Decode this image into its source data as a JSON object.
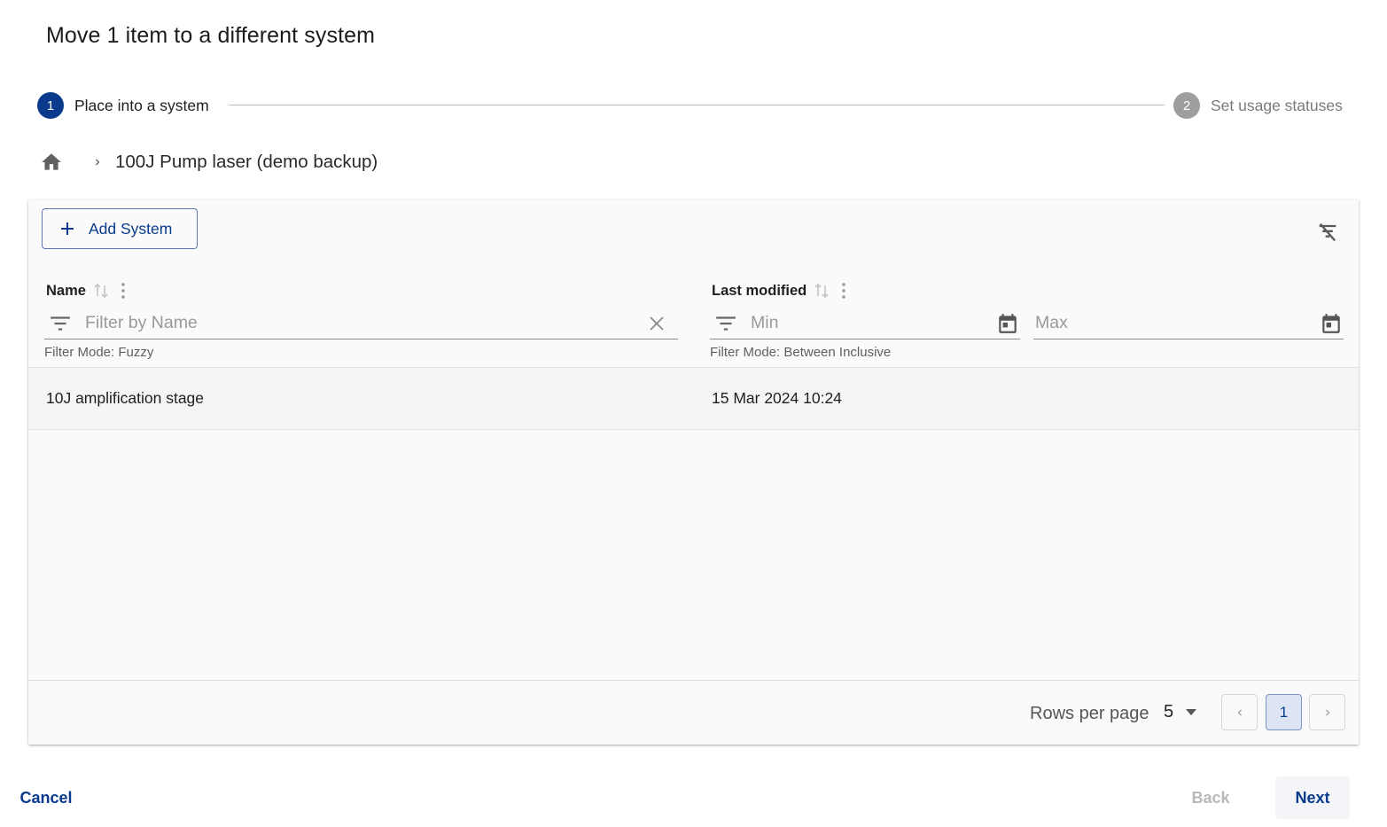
{
  "dialog": {
    "title": "Move 1 item to a different system"
  },
  "stepper": {
    "steps": [
      {
        "number": "1",
        "label": "Place into a system",
        "state": "active"
      },
      {
        "number": "2",
        "label": "Set usage statuses",
        "state": "inactive"
      }
    ]
  },
  "breadcrumb": {
    "home_icon": "home-icon",
    "separator_icon": "chevron-right-icon",
    "current": "100J Pump laser (demo backup)"
  },
  "toolbar": {
    "add_label": "Add System",
    "clear_filters_icon": "filter-off-icon"
  },
  "table": {
    "columns": [
      {
        "label": "Name",
        "filter_placeholder": "Filter by Name",
        "filter_mode": "Filter Mode: Fuzzy"
      },
      {
        "label": "Last modified",
        "min_placeholder": "Min",
        "max_placeholder": "Max",
        "filter_mode": "Filter Mode: Between Inclusive"
      }
    ],
    "rows": [
      {
        "name": "10J amplification stage",
        "last_modified": "15 Mar 2024 10:24"
      }
    ]
  },
  "pagination": {
    "rows_per_page_label": "Rows per page",
    "rows_per_page_value": "5",
    "current_page": "1"
  },
  "actions": {
    "cancel": "Cancel",
    "back": "Back",
    "next": "Next"
  },
  "colors": {
    "primary": "#093a8c",
    "inactive_step": "#9e9e9e",
    "disabled_text": "#b9b9b9"
  }
}
